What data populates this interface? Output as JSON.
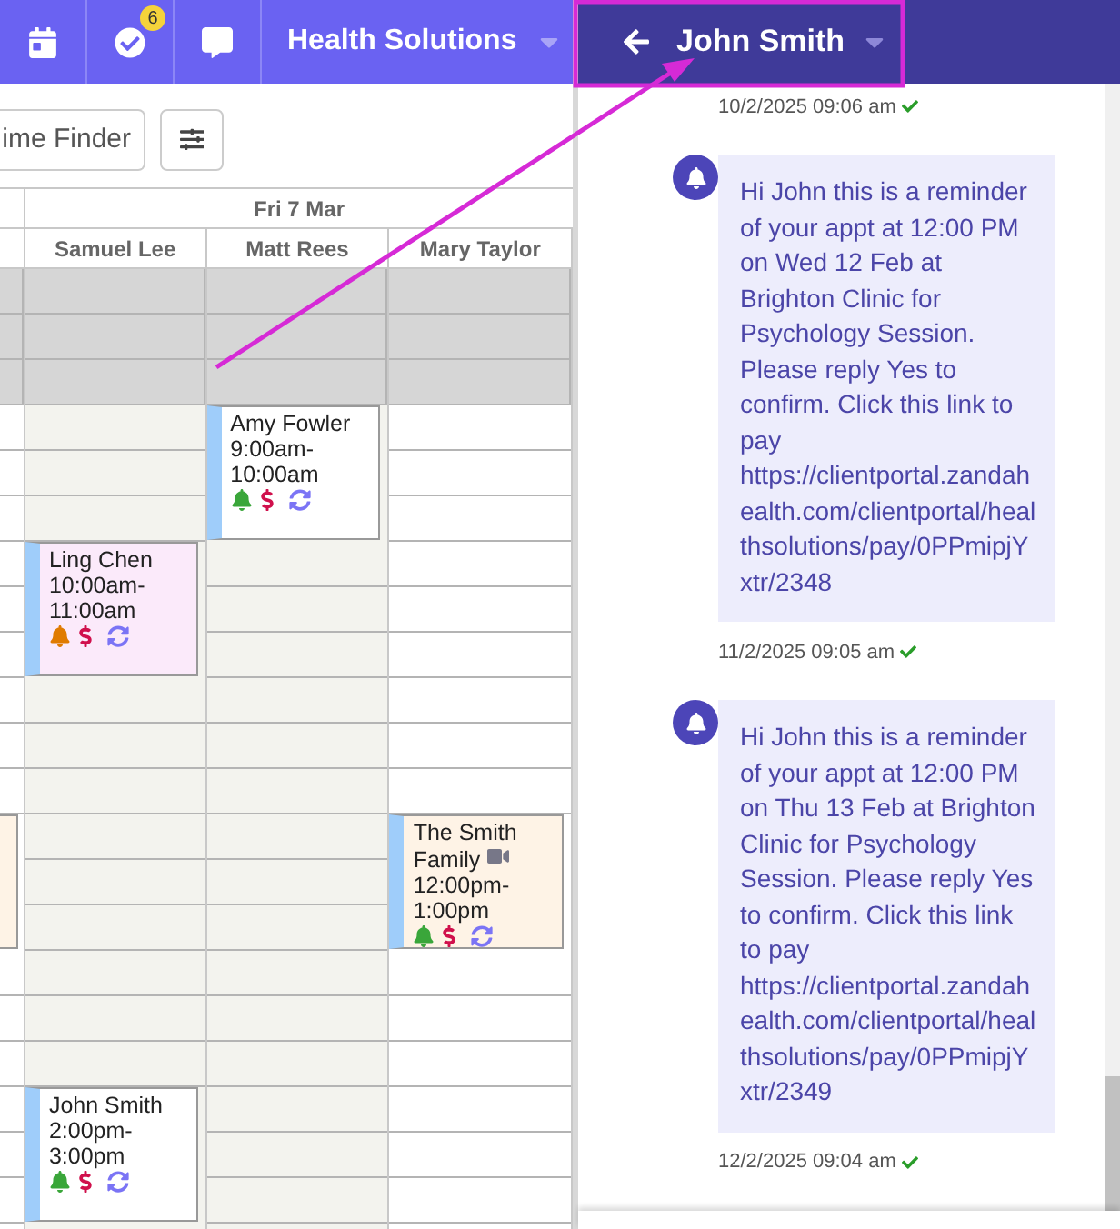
{
  "nav": {
    "badge": "6",
    "org": "Health Solutions"
  },
  "toolbar": {
    "time_finder": "ime Finder"
  },
  "calendar": {
    "day": "Fri 7 Mar",
    "columns": [
      {
        "kind": "gutter",
        "shaded": false,
        "cells": [
          {
            "kind": "slot",
            "blocked": true
          },
          {
            "kind": "slot",
            "blocked": true
          },
          {
            "kind": "slot",
            "blocked": true
          },
          {
            "kind": "slot",
            "blocked": false
          },
          {
            "kind": "slot",
            "blocked": false
          },
          {
            "kind": "slot",
            "blocked": false
          },
          {
            "kind": "slot",
            "blocked": false
          },
          {
            "kind": "slot",
            "blocked": false
          },
          {
            "kind": "slot",
            "blocked": false
          },
          {
            "kind": "slot",
            "blocked": false
          },
          {
            "kind": "slot",
            "blocked": false
          },
          {
            "kind": "slot",
            "blocked": false
          },
          {
            "kind": "partial",
            "color": "#fef3e6"
          },
          {
            "kind": "slot",
            "blocked": false
          },
          {
            "kind": "slot",
            "blocked": false
          },
          {
            "kind": "slot",
            "blocked": false
          },
          {
            "kind": "slot",
            "blocked": false
          },
          {
            "kind": "slot",
            "blocked": false
          },
          {
            "kind": "slot",
            "blocked": false
          }
        ]
      },
      {
        "kind": "staff",
        "name": "Samuel Lee",
        "shaded": true,
        "cells": [
          {
            "kind": "slot",
            "blocked": true
          },
          {
            "kind": "slot",
            "blocked": true
          },
          {
            "kind": "slot",
            "blocked": true
          },
          {
            "kind": "slot",
            "blocked": false
          },
          {
            "kind": "slot",
            "blocked": false
          },
          {
            "kind": "slot",
            "blocked": false
          },
          {
            "kind": "appointment",
            "color": "#fbeafa",
            "client": "Ling Chen",
            "time": "10:00am-11:00am",
            "reminder_sent": false,
            "video": false
          },
          {
            "kind": "slot",
            "blocked": false
          },
          {
            "kind": "slot",
            "blocked": false
          },
          {
            "kind": "slot",
            "blocked": false
          },
          {
            "kind": "slot",
            "blocked": false
          },
          {
            "kind": "slot",
            "blocked": false
          },
          {
            "kind": "slot",
            "blocked": false
          },
          {
            "kind": "slot",
            "blocked": false
          },
          {
            "kind": "slot",
            "blocked": false
          },
          {
            "kind": "slot",
            "blocked": false
          },
          {
            "kind": "appointment",
            "color": "#ffffff",
            "client": "John Smith",
            "time": "2:00pm-3:00pm",
            "reminder_sent": true,
            "video": false
          }
        ]
      },
      {
        "kind": "staff",
        "name": "Matt Rees",
        "shaded": true,
        "cells": [
          {
            "kind": "slot",
            "blocked": true
          },
          {
            "kind": "slot",
            "blocked": true
          },
          {
            "kind": "slot",
            "blocked": true
          },
          {
            "kind": "appointment",
            "color": "#ffffff",
            "client": "Amy Fowler",
            "time": "9:00am-10:00am",
            "reminder_sent": true,
            "video": false
          },
          {
            "kind": "slot",
            "blocked": false
          },
          {
            "kind": "slot",
            "blocked": false
          },
          {
            "kind": "slot",
            "blocked": false
          },
          {
            "kind": "slot",
            "blocked": false
          },
          {
            "kind": "slot",
            "blocked": false
          },
          {
            "kind": "slot",
            "blocked": false
          },
          {
            "kind": "slot",
            "blocked": false
          },
          {
            "kind": "slot",
            "blocked": false
          },
          {
            "kind": "slot",
            "blocked": false
          },
          {
            "kind": "slot",
            "blocked": false
          },
          {
            "kind": "slot",
            "blocked": false
          },
          {
            "kind": "slot",
            "blocked": false
          },
          {
            "kind": "slot",
            "blocked": false
          },
          {
            "kind": "slot",
            "blocked": false
          },
          {
            "kind": "slot",
            "blocked": false
          }
        ]
      },
      {
        "kind": "staff",
        "name": "Mary Taylor",
        "shaded": false,
        "cells": [
          {
            "kind": "slot",
            "blocked": true
          },
          {
            "kind": "slot",
            "blocked": true
          },
          {
            "kind": "slot",
            "blocked": true
          },
          {
            "kind": "slot",
            "blocked": false
          },
          {
            "kind": "slot",
            "blocked": false
          },
          {
            "kind": "slot",
            "blocked": false
          },
          {
            "kind": "slot",
            "blocked": false
          },
          {
            "kind": "slot",
            "blocked": false
          },
          {
            "kind": "slot",
            "blocked": false
          },
          {
            "kind": "slot",
            "blocked": false
          },
          {
            "kind": "slot",
            "blocked": false
          },
          {
            "kind": "slot",
            "blocked": false
          },
          {
            "kind": "appointment",
            "color": "#fef3e6",
            "client": "The Smith Family",
            "time": "12:00pm-1:00pm",
            "reminder_sent": true,
            "video": true
          },
          {
            "kind": "slot",
            "blocked": false
          },
          {
            "kind": "slot",
            "blocked": false
          },
          {
            "kind": "slot",
            "blocked": false
          },
          {
            "kind": "slot",
            "blocked": false
          },
          {
            "kind": "slot",
            "blocked": false
          },
          {
            "kind": "slot",
            "blocked": false
          }
        ]
      }
    ]
  },
  "chat": {
    "contact": "John Smith",
    "thread": [
      {
        "kind": "timestamp",
        "text": "10/2/2025 09:06 am",
        "delivered": true
      },
      {
        "kind": "bubble",
        "text": "Hi John this is a reminder of your appt at 12:00 PM on Wed 12 Feb at Brighton Clinic for Psychology Session. Please reply Yes to confirm. Click this link to pay https://clientportal.zandahealth.com/clientportal/healthsolutions/pay/0PPmipjYxtr/2348"
      },
      {
        "kind": "timestamp",
        "text": "11/2/2025 09:05 am",
        "delivered": true
      },
      {
        "kind": "bubble",
        "text": "Hi John this is a reminder of your appt at 12:00 PM on Thu 13 Feb at Brighton Clinic for Psychology Session. Please reply Yes to confirm. Click this link to pay https://clientportal.zandahealth.com/clientportal/healthsolutions/pay/0PPmipjYxtr/2349"
      },
      {
        "kind": "timestamp",
        "text": "12/2/2025 09:04 am",
        "delivered": true
      }
    ]
  }
}
